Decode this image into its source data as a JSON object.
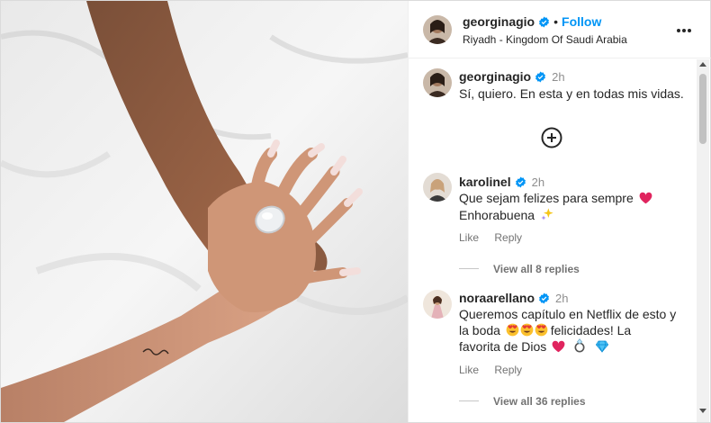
{
  "post": {
    "author": "georginagio",
    "dot": "•",
    "follow_label": "Follow",
    "location": "Riyadh - Kingdom Of Saudi Arabia"
  },
  "caption": {
    "author": "georginagio",
    "time": "2h",
    "text": "Sí, quiero. En esta y en todas mis vidas."
  },
  "comments": [
    {
      "author": "karolinel",
      "time": "2h",
      "line1": "Que sejam felizes para sempre",
      "line2": "Enhorabuena",
      "like_label": "Like",
      "reply_label": "Reply",
      "view_replies": "View all 8 replies"
    },
    {
      "author": "noraarellano",
      "time": "2h",
      "line1": "Queremos capítulo en Netflix de esto y",
      "line2": "la boda",
      "line2_after": "felicidades! La",
      "line3": "favorita de Dios",
      "like_label": "Like",
      "reply_label": "Reply",
      "view_replies": "View all 36 replies"
    }
  ],
  "icons": {
    "verified": "verified-badge-icon",
    "more": "more-options-icon",
    "add": "add-circle-icon",
    "heart": "red-heart-emoji",
    "sparkles": "sparkles-emoji",
    "heart_eyes": "heart-eyes-emoji",
    "ring": "ring-emoji",
    "gem": "gem-emoji"
  },
  "colors": {
    "accent": "#0095f6",
    "verified": "#0095f6",
    "heart": "#e0245e"
  }
}
